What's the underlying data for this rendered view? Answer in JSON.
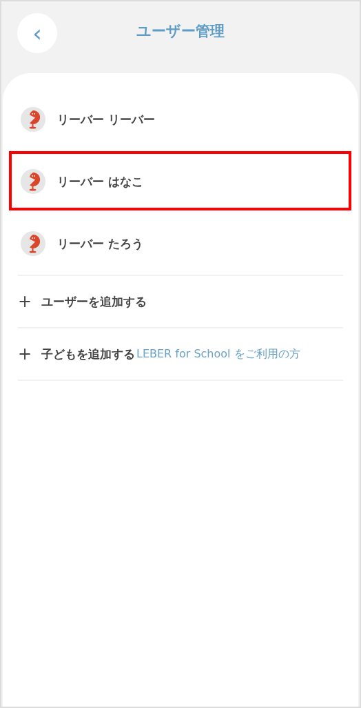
{
  "header": {
    "back": "‹",
    "title": "ユーザー管理"
  },
  "users": [
    {
      "name": "リーバー リーバー",
      "highlighted": false
    },
    {
      "name": "リーバー はなこ",
      "highlighted": true
    },
    {
      "name": "リーバー たろう",
      "highlighted": false
    }
  ],
  "actions": [
    {
      "icon": "+",
      "label": "ユーザーを追加する"
    },
    {
      "icon": "+",
      "label": "子どもを追加する",
      "note": "LEBER for School をご利用の方"
    }
  ]
}
